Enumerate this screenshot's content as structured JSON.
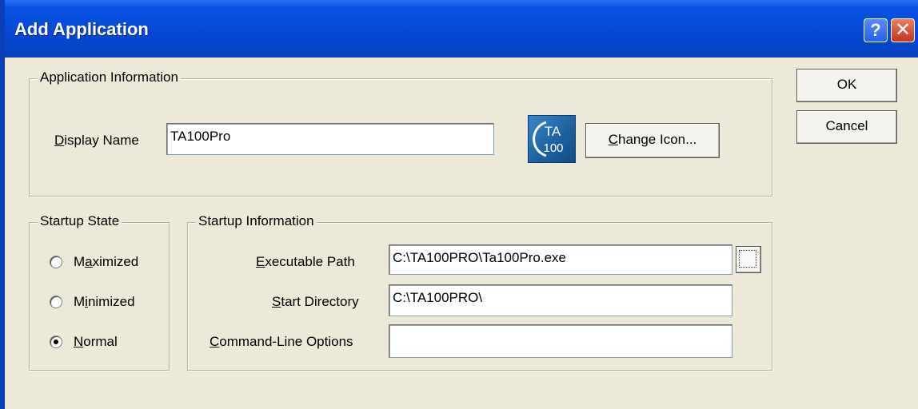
{
  "window": {
    "title": "Add Application"
  },
  "titlebar_buttons": {
    "help": "?",
    "close": "✕"
  },
  "app_info": {
    "legend": "Application Information",
    "display_name_label": "Display Name",
    "display_name_value": "TA100Pro",
    "change_icon_button": "Change Icon...",
    "icon_text_top": "TA",
    "icon_text_bottom": "100"
  },
  "startup_state": {
    "legend": "Startup State",
    "options": [
      {
        "label": "Maximized",
        "checked": false
      },
      {
        "label": "Minimized",
        "checked": false
      },
      {
        "label": "Normal",
        "checked": true
      }
    ]
  },
  "startup_info": {
    "legend": "Startup Information",
    "executable_path_label": "Executable Path",
    "executable_path_value": "C:\\TA100PRO\\Ta100Pro.exe",
    "start_directory_label": "Start Directory",
    "start_directory_value": "C:\\TA100PRO\\",
    "command_line_label": "Command-Line Options",
    "command_line_value": "",
    "browse_button": "..."
  },
  "actions": {
    "ok": "OK",
    "cancel": "Cancel"
  },
  "colors": {
    "titlebar": "#0a54e3",
    "dialog_bg": "#ece9d8"
  }
}
